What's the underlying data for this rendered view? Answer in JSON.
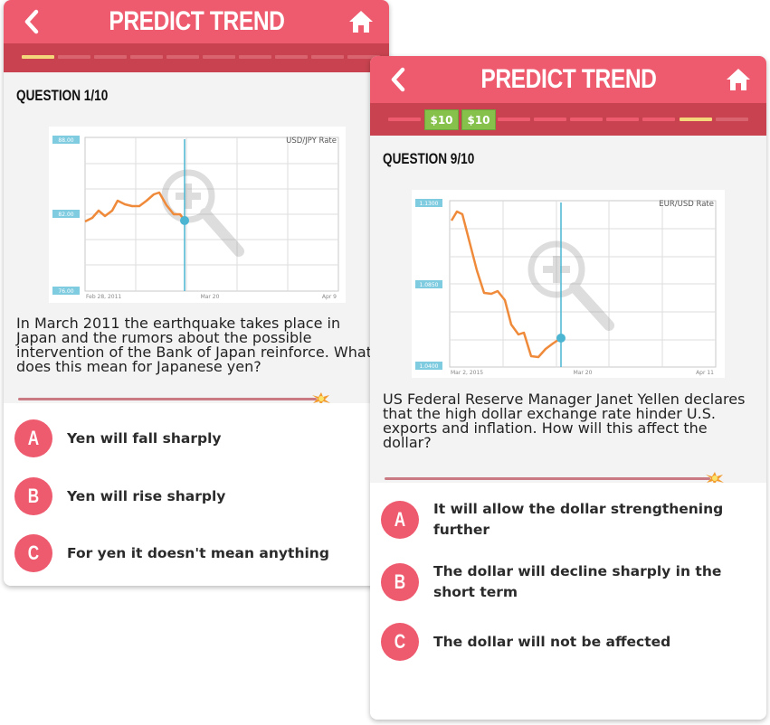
{
  "screens": [
    {
      "title": "PREDICT TREND",
      "question_label": "QUESTION 1/10",
      "chart": {
        "legend_label": "USD/JPY Rate",
        "y_labels": [
          "88.00",
          "82.00",
          "76.00"
        ],
        "x_labels": [
          "Feb 28, 2011",
          "Mar 20",
          "Apr 9"
        ]
      },
      "question_text": "In March 2011 the earthquake takes place in Japan and the rumors about the possible intervention of the Bank of Japan reinforce. What does this mean for Japanese yen?",
      "answers": [
        {
          "letter": "A",
          "text": "Yen will fall sharply"
        },
        {
          "letter": "B",
          "text": "Yen will rise sharply"
        },
        {
          "letter": "C",
          "text": "For yen it doesn't mean anything"
        }
      ]
    },
    {
      "title": "PREDICT TREND",
      "question_label": "QUESTION 9/10",
      "progress_rewards": [
        "$10",
        "$10"
      ],
      "chart": {
        "legend_label": "EUR/USD Rate",
        "y_labels": [
          "1.1300",
          "1.0850",
          "1.0400"
        ],
        "x_labels": [
          "Mar 2, 2015",
          "Mar 20",
          "Apr 11"
        ]
      },
      "question_text": "US Federal Reserve Manager Janet Yellen declares that the high dollar exchange rate hinder U.S. exports and inflation. How will this affect the dollar?",
      "answers": [
        {
          "letter": "A",
          "text": "It will allow the dollar strengthening further"
        },
        {
          "letter": "B",
          "text": "The dollar will decline sharply in the short term"
        },
        {
          "letter": "C",
          "text": "The dollar will not be affected"
        }
      ]
    }
  ],
  "colors": {
    "header": "#ee5a6e",
    "progress_bar": "#c8434f",
    "current_segment": "#f4d77a",
    "reward": "#86c14b",
    "line": "#ef8a3a",
    "marker": "#4bb5d2"
  },
  "icons": [
    "back-arrow-icon",
    "home-icon",
    "zoom-in-icon",
    "spark-icon"
  ]
}
